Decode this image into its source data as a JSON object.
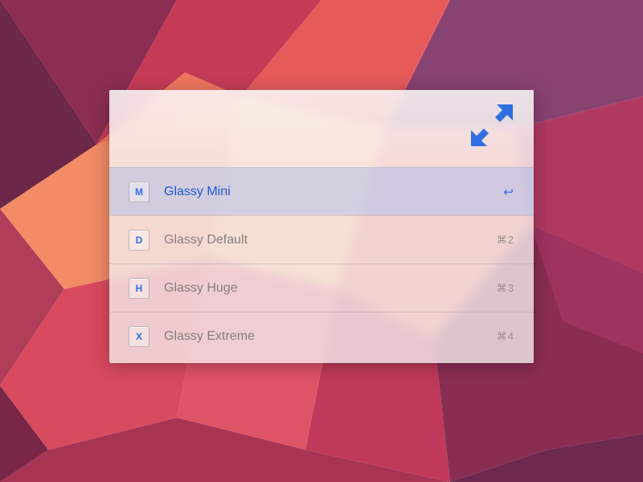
{
  "colors": {
    "accent": "#2f6fe4",
    "muted_text": "#8a7d7d"
  },
  "icons": {
    "header": "expand-fullscreen",
    "selected_shortcut_glyph": "↩"
  },
  "items": [
    {
      "key": "M",
      "label": "Glassy Mini",
      "shortcut": "↩",
      "selected": true
    },
    {
      "key": "D",
      "label": "Glassy Default",
      "shortcut": "⌘2",
      "selected": false
    },
    {
      "key": "H",
      "label": "Glassy Huge",
      "shortcut": "⌘3",
      "selected": false
    },
    {
      "key": "X",
      "label": "Glassy Extreme",
      "shortcut": "⌘4",
      "selected": false
    }
  ]
}
